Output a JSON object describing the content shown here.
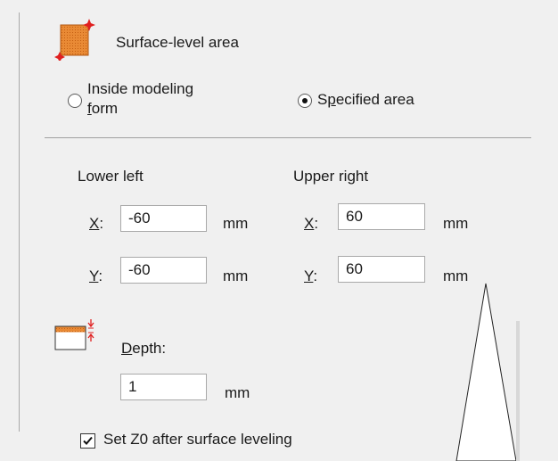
{
  "surface_section": {
    "title": "Surface-level area",
    "icon": "surface-area-icon",
    "accent_color": "#e07b2a",
    "radio_inside": {
      "label": "Inside modeling form",
      "line1": "Inside modeling",
      "line2_mnemonic": "f",
      "line2_rest": "orm",
      "selected": false
    },
    "radio_specified": {
      "label": "Specified area",
      "prefix": "S",
      "mnemonic": "p",
      "rest": "ecified area",
      "selected": true
    }
  },
  "lower_left": {
    "heading": "Lower left",
    "x_label": "X",
    "y_label": "Y",
    "colon": ":",
    "x_value": "-60",
    "y_value": "-60",
    "unit": "mm"
  },
  "upper_right": {
    "heading": "Upper right",
    "x_label": "X",
    "y_label": "Y",
    "colon": ":",
    "x_value": "60",
    "y_value": "60",
    "unit": "mm"
  },
  "depth": {
    "icon": "depth-icon",
    "label_mnemonic": "D",
    "label_rest": "epth:",
    "value": "1",
    "unit": "mm"
  },
  "set_z0": {
    "label": "Set Z0 after surface leveling",
    "checked": true
  }
}
